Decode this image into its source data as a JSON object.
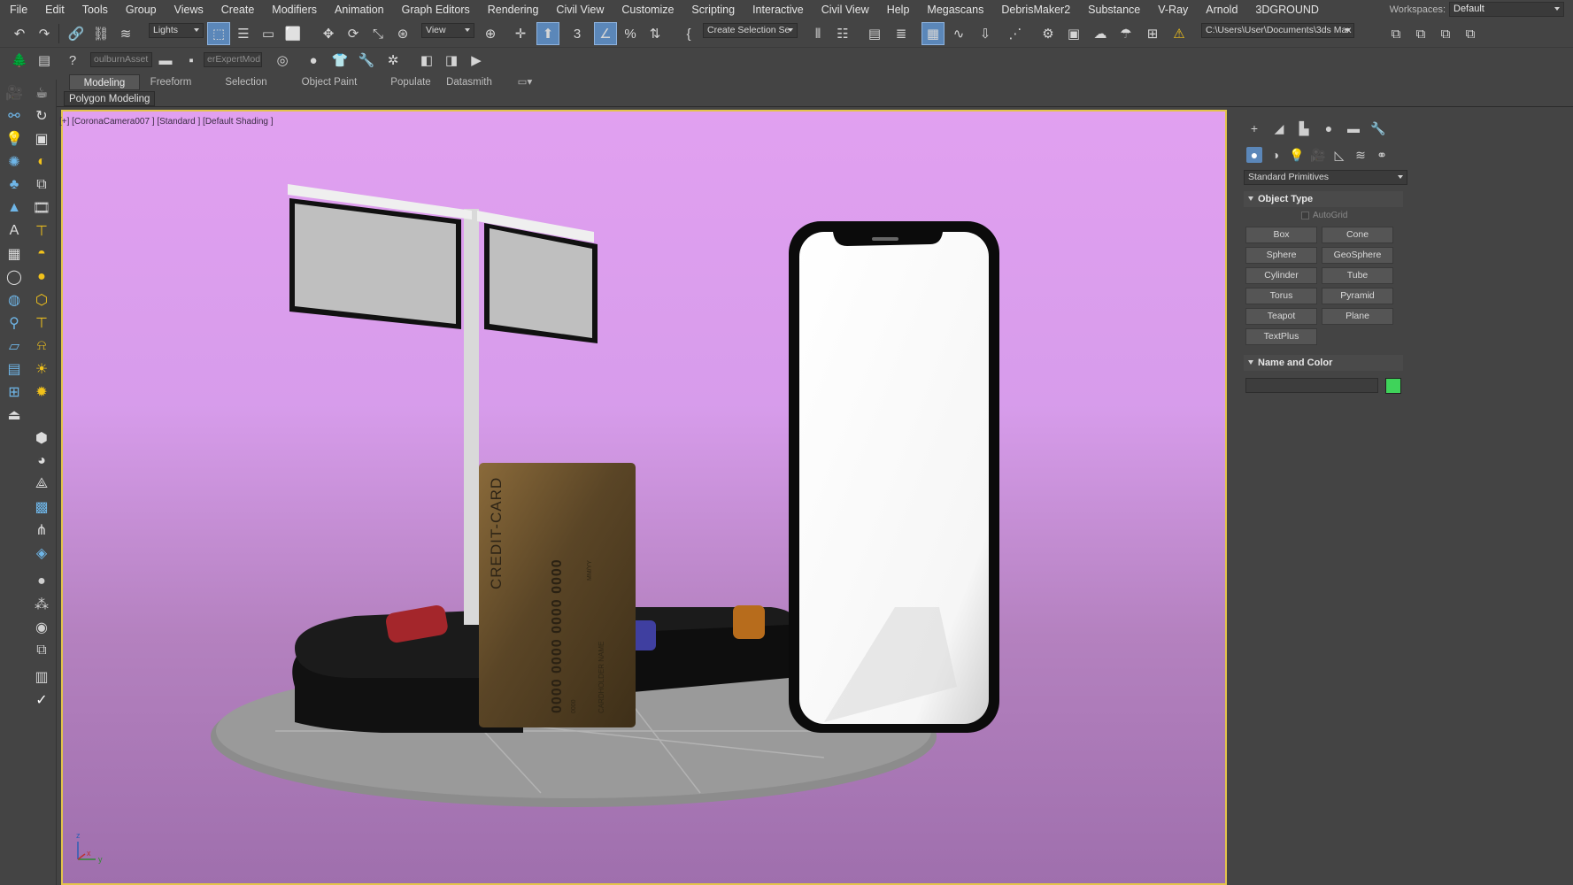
{
  "menu": [
    "File",
    "Edit",
    "Tools",
    "Group",
    "Views",
    "Create",
    "Modifiers",
    "Animation",
    "Graph Editors",
    "Rendering",
    "Civil View",
    "Customize",
    "Scripting",
    "Interactive",
    "Civil View",
    "Help",
    "Megascans",
    "DebrisMaker2",
    "Substance",
    "V-Ray",
    "Arnold",
    "3DGROUND"
  ],
  "workspaces": {
    "label": "Workspaces:",
    "value": "Default"
  },
  "toolbar": {
    "selection_filter": "Lights",
    "ref_coord": "View",
    "named_selection": "Create Selection Se",
    "project_path": "C:\\Users\\User\\Documents\\3ds Max 2022",
    "plugin1": "oulburnAsset",
    "plugin2": "erExpertMod"
  },
  "ribbon": {
    "tabs": [
      "Modeling",
      "Freeform",
      "Selection",
      "Object Paint",
      "Populate",
      "Datasmith"
    ],
    "active_tab": "Modeling",
    "sub_label": "Polygon Modeling"
  },
  "viewport": {
    "label": "[+] [CoronaCamera007 ] [Standard ] [Default Shading ]",
    "card_text": "CREDIT-CARD",
    "card_number": "0000 0000 0000 0000",
    "card_holder": "CARDHOLDER NAME",
    "card_date": "MM/YY",
    "card_code": "0000",
    "axis_z": "z",
    "axis_x": "x",
    "axis_y": "y"
  },
  "command_panel": {
    "dropdown": "Standard Primitives",
    "object_type": {
      "title": "Object Type",
      "autogrid": "AutoGrid",
      "buttons": [
        "Box",
        "Cone",
        "Sphere",
        "GeoSphere",
        "Cylinder",
        "Tube",
        "Torus",
        "Pyramid",
        "Teapot",
        "Plane",
        "TextPlus"
      ]
    },
    "name_and_color": {
      "title": "Name and Color",
      "name_value": "",
      "color": "#3fd35a"
    }
  },
  "colors": {
    "accent": "#5b87b9",
    "viewport_border": "#e3c44a",
    "warning": "#f2c21b"
  }
}
